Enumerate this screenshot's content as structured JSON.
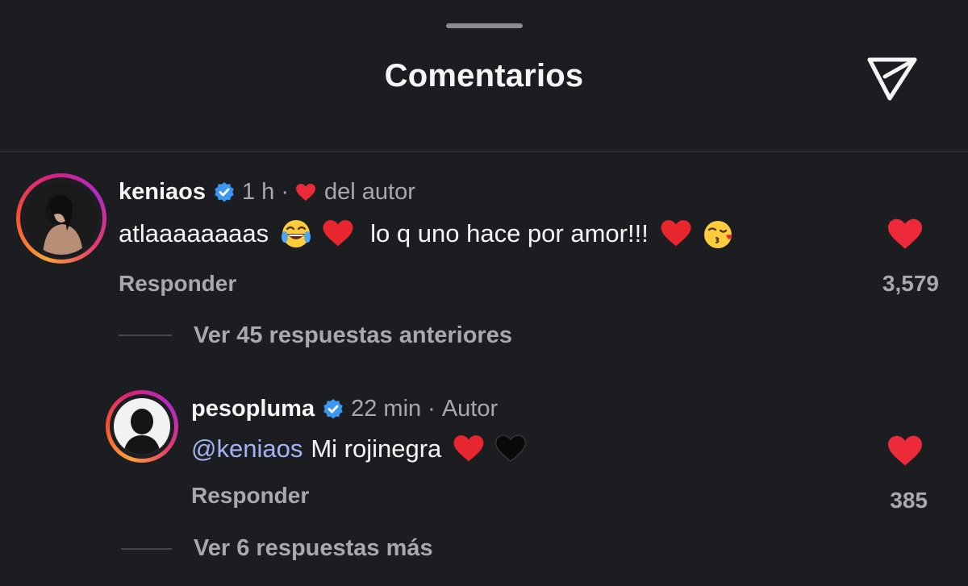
{
  "header": {
    "title": "Comentarios",
    "share_icon": "paper-plane-icon"
  },
  "comments": [
    {
      "username": "keniaos",
      "verified": true,
      "time": "1 h",
      "author_like_label": "del autor",
      "text": "atlaaaaaaaas",
      "text_2": "lo q uno hace por amor!!!",
      "reply_label": "Responder",
      "likes": "3,579",
      "liked": true
    }
  ],
  "view_previous": "Ver 45 respuestas anteriores",
  "replies": [
    {
      "username": "pesopluma",
      "verified": true,
      "time": "22 min",
      "badge": "Autor",
      "mention": "@keniaos",
      "text": "Mi rojinegra",
      "reply_label": "Responder",
      "likes": "385",
      "liked": true
    }
  ],
  "view_more": "Ver 6 respuestas más",
  "colors": {
    "background": "#1c1d21",
    "like_red": "#ed2a3a",
    "verified_blue": "#3b97f0",
    "mention": "#a5b3f5",
    "secondary_text": "#a8a9ae"
  }
}
